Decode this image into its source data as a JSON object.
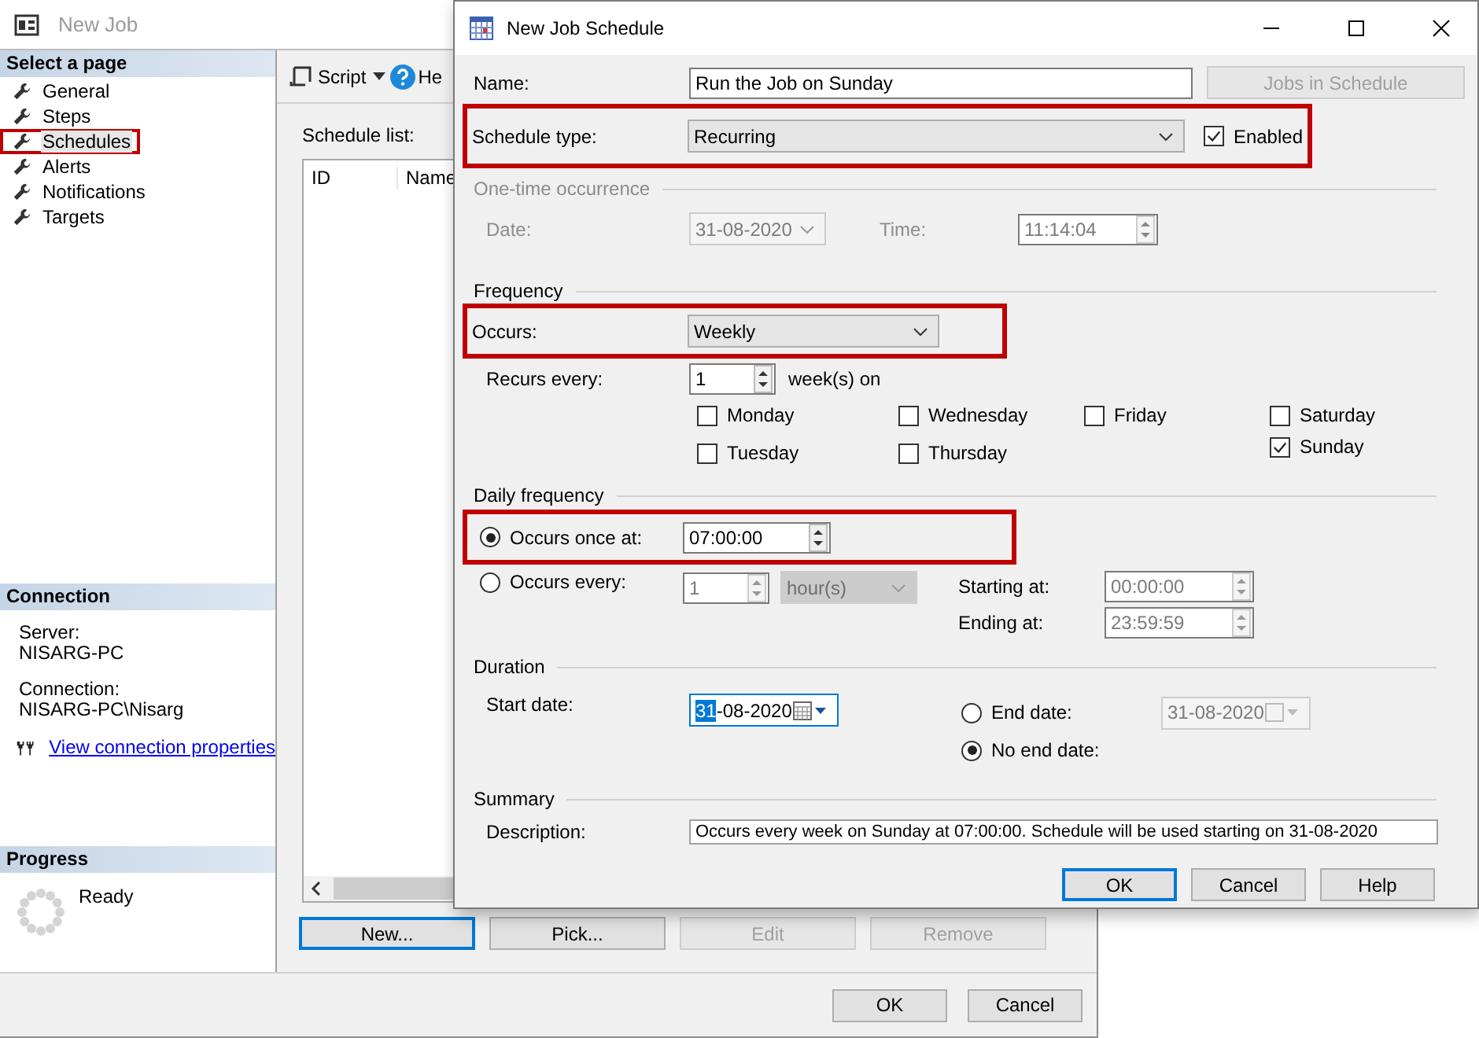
{
  "main_window": {
    "title": "New Job",
    "pages": {
      "header": "Select a page",
      "items": [
        {
          "label": "General",
          "selected": false,
          "highlighted": false
        },
        {
          "label": "Steps",
          "selected": false,
          "highlighted": false
        },
        {
          "label": "Schedules",
          "selected": true,
          "highlighted": true
        },
        {
          "label": "Alerts",
          "selected": false,
          "highlighted": false
        },
        {
          "label": "Notifications",
          "selected": false,
          "highlighted": false
        },
        {
          "label": "Targets",
          "selected": false,
          "highlighted": false
        }
      ]
    },
    "connection": {
      "header": "Connection",
      "server_label": "Server:",
      "server": "NISARG-PC",
      "connection_label": "Connection:",
      "connection": "NISARG-PC\\Nisarg",
      "link": "View connection properties"
    },
    "progress": {
      "header": "Progress",
      "status": "Ready"
    },
    "toolbar": {
      "script": "Script",
      "help": "He"
    },
    "schedule_list": {
      "label": "Schedule list:",
      "columns": [
        "ID",
        "Name"
      ]
    },
    "list_buttons": [
      {
        "label": "New...",
        "disabled": false,
        "default": true
      },
      {
        "label": "Pick...",
        "disabled": false,
        "default": false
      },
      {
        "label": "Edit",
        "disabled": true,
        "default": false
      },
      {
        "label": "Remove",
        "disabled": true,
        "default": false
      }
    ],
    "buttons": [
      {
        "label": "OK"
      },
      {
        "label": "Cancel"
      }
    ]
  },
  "dialog": {
    "title": "New Job Schedule",
    "name": {
      "label": "Name:",
      "value": "Run the Job on Sunday"
    },
    "jobs_in_schedule": {
      "label": "Jobs in Schedule",
      "disabled": true
    },
    "schedule_type": {
      "label": "Schedule type:",
      "value": "Recurring",
      "highlighted": true
    },
    "enabled": {
      "label": "Enabled",
      "checked": true
    },
    "one_time": {
      "title": "One-time occurrence",
      "disabled": true,
      "date_label": "Date:",
      "date": "31-08-2020",
      "time_label": "Time:",
      "time": "11:14:04"
    },
    "frequency": {
      "title": "Frequency",
      "occurs_label": "Occurs:",
      "occurs": "Weekly",
      "highlighted": true,
      "recurs_label": "Recurs every:",
      "recurs_value": "1",
      "recurs_unit": "week(s) on",
      "day_columns": [
        [
          {
            "label": "Monday",
            "checked": false
          },
          {
            "label": "Tuesday",
            "checked": false
          }
        ],
        [
          {
            "label": "Wednesday",
            "checked": false
          },
          {
            "label": "Thursday",
            "checked": false
          }
        ],
        [
          {
            "label": "Friday",
            "checked": false
          }
        ],
        [
          {
            "label": "Saturday",
            "checked": false
          },
          {
            "label": "Sunday",
            "checked": true
          }
        ]
      ]
    },
    "daily_frequency": {
      "title": "Daily frequency",
      "options": [
        {
          "kind": "once",
          "label": "Occurs once at:",
          "selected": true,
          "highlighted": true,
          "value": "07:00:00"
        },
        {
          "kind": "every",
          "label": "Occurs every:",
          "selected": false,
          "highlighted": false,
          "value": "1",
          "unit": "hour(s)",
          "starting_label": "Starting at:",
          "starting": "00:00:00",
          "ending_label": "Ending at:",
          "ending": "23:59:59"
        }
      ]
    },
    "duration": {
      "title": "Duration",
      "start_label": "Start date:",
      "start_date": {
        "selected_part": "31",
        "rest": "-08-2020"
      },
      "end_options": [
        {
          "kind": "end_date",
          "label": "End date:",
          "selected": false,
          "value": "31-08-2020"
        },
        {
          "kind": "no_end",
          "label": "No end date:",
          "selected": true
        }
      ]
    },
    "summary": {
      "title": "Summary",
      "description_label": "Description:",
      "description": "Occurs every week on Sunday at 07:00:00. Schedule will be used starting on 31-08-2020"
    },
    "buttons": [
      {
        "label": "OK",
        "default": true
      },
      {
        "label": "Cancel",
        "default": false
      },
      {
        "label": "Help",
        "default": false
      }
    ]
  }
}
